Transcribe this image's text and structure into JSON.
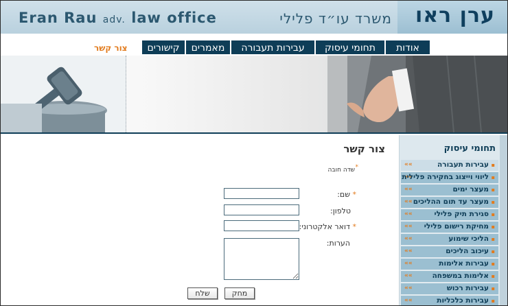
{
  "header": {
    "hebrew_name": "ערן ראו",
    "hebrew_subtitle": "משרד עו״ד פלילי",
    "english_name": "Eran Rau",
    "english_adv": "adv.",
    "english_suffix": "law office"
  },
  "nav": {
    "tabs": [
      {
        "label": "אודות"
      },
      {
        "label": "תחומי עיסוק"
      },
      {
        "label": "עבירות תעבורה"
      },
      {
        "label": "מאמרים"
      },
      {
        "label": "קישורים"
      }
    ],
    "contact_link": "צור קשר"
  },
  "sidebar": {
    "title": "תחומי עיסוק",
    "items": [
      {
        "label": "עבירות תעבורה"
      },
      {
        "label": "ליווי וייצוג בחקירה פלילית"
      },
      {
        "label": "מעצר ימים"
      },
      {
        "label": "מעצר עד תום ההליכים"
      },
      {
        "label": "סגירת תיק פלילי"
      },
      {
        "label": "מחיקת רישום פלילי"
      },
      {
        "label": "הליכי שימוע"
      },
      {
        "label": "עיכוב הליכים"
      },
      {
        "label": "עבירות אלימות"
      },
      {
        "label": "אלימות במשפחה"
      },
      {
        "label": "עבירות רכוש"
      },
      {
        "label": "עבירות כלכליות"
      }
    ],
    "arrow_glyph": "««",
    "bullet_glyph": "▪"
  },
  "content": {
    "title": "צור קשר",
    "required_note": "שדה חובה",
    "required_star": "*",
    "form": {
      "name_label": "שם:",
      "phone_label": "טלפון:",
      "email_label": "דואר אלקטרוני:",
      "notes_label": "הערות:",
      "name_value": "",
      "phone_value": "",
      "email_value": "",
      "notes_value": ""
    },
    "buttons": {
      "submit": "שלח",
      "clear": "מחק"
    }
  },
  "colors": {
    "navy": "#0e3d57",
    "accent_orange": "#e27b1d",
    "sidebar_item": "#9bbfd1"
  }
}
